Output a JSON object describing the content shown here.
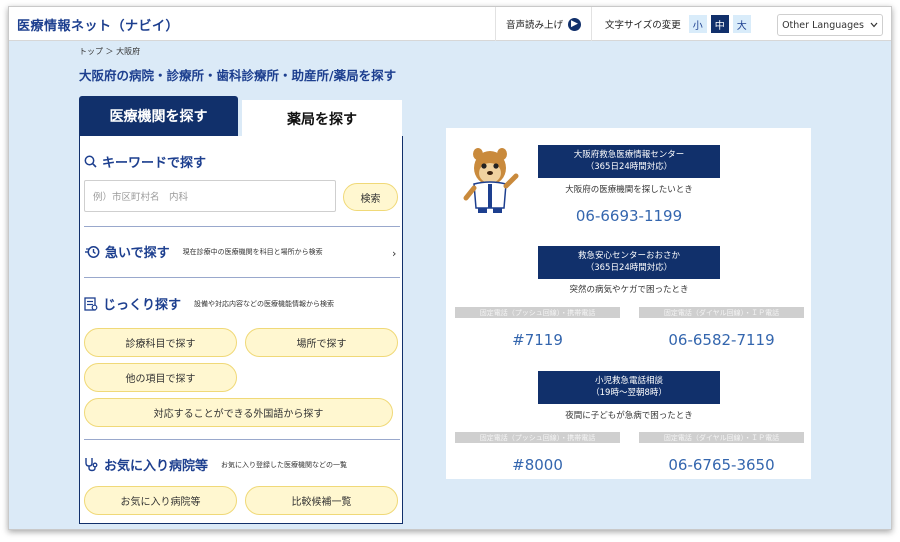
{
  "header": {
    "logo": "医療情報ネット（ナビイ）",
    "voice_label": "音声読み上げ",
    "font_size_label": "文字サイズの変更",
    "font_sizes": [
      "小",
      "中",
      "大"
    ],
    "font_size_selected": "中",
    "language_label": "Other Languages"
  },
  "breadcrumb": "トップ ＞ 大阪府",
  "page_title": "大阪府の病院・診療所・歯科診療所・助産所/薬局を探す",
  "tabs": {
    "medical": "医療機関を探す",
    "pharmacy": "薬局を探す"
  },
  "keyword": {
    "title": "キーワードで探す",
    "placeholder": "例）市区町村名　内科",
    "search_button": "検索"
  },
  "urgent": {
    "title": "急いで探す",
    "desc": "現在診療中の医療機関を科目と場所から検索"
  },
  "detailed": {
    "title": "じっくり探す",
    "desc": "設備や対応内容などの医療機能情報から検索",
    "buttons": [
      "診療科目で探す",
      "場所で探す",
      "他の項目で探す",
      "対応することができる外国語から探す"
    ]
  },
  "favorites": {
    "title": "お気に入り病院等",
    "desc": "お気に入り登録した医療機関などの一覧",
    "buttons": [
      "お気に入り病院等",
      "比較候補一覧"
    ]
  },
  "emergency": {
    "center1": {
      "line1": "大阪府救急医療情報センター",
      "line2": "（365日24時間対応）",
      "desc": "大阪府の医療機関を探したいとき",
      "phone": "06-6693-1199"
    },
    "center2": {
      "line1": "救急安心センターおおさか",
      "line2": "（365日24時間対応）",
      "desc": "突然の病気やケガで困ったとき",
      "label_mobile": "固定電話（プッシュ回線）・携帯電話",
      "label_dial": "固定電話（ダイヤル回線）・ＩＰ電話",
      "phone_short": "#7119",
      "phone": "06-6582-7119"
    },
    "center3": {
      "line1": "小児救急電話相談",
      "line2": "（19時〜翌朝8時）",
      "desc": "夜間に子どもが急病で困ったとき",
      "label_mobile": "固定電話（プッシュ回線）・携帯電話",
      "label_dial": "固定電話（ダイヤル回線）・ＩＰ電話",
      "phone_short": "#8000",
      "phone": "06-6765-3650"
    }
  },
  "colors": {
    "navy": "#11306b",
    "link_blue": "#3466ae",
    "pill_bg": "#fff7d0",
    "pill_border": "#f0d978",
    "page_bg": "#dbeaf7"
  },
  "icons": [
    "search-icon",
    "clock-icon",
    "list-icon",
    "stethoscope-icon",
    "play-circle-icon",
    "chevron-down-icon",
    "chevron-right-icon",
    "mascot-illustration"
  ]
}
